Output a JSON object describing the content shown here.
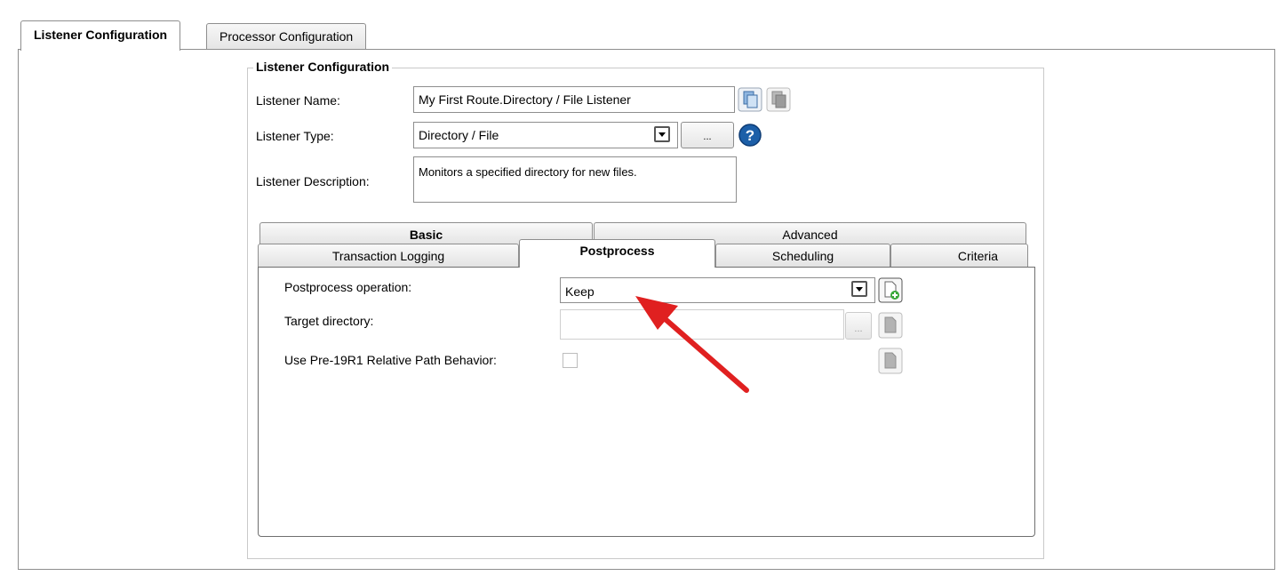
{
  "top_tabs": [
    {
      "label": "Listener Configuration",
      "active": true
    },
    {
      "label": "Processor Configuration",
      "active": false
    }
  ],
  "group": {
    "title": "Listener Configuration",
    "name_label": "Listener Name:",
    "name_value": "My First Route.Directory / File Listener",
    "type_label": "Listener Type:",
    "type_value": "Directory / File",
    "type_dots": "...",
    "description_label": "Listener Description:",
    "description_value": "Monitors a specified directory for new files."
  },
  "inner_tabs_row1": [
    "Basic",
    "Advanced"
  ],
  "inner_tabs_row2": [
    "Transaction Logging",
    "Postprocess",
    "Scheduling",
    "Criteria"
  ],
  "active_inner_tab": "Postprocess",
  "postprocess": {
    "operation_label": "Postprocess operation:",
    "operation_value": "Keep",
    "target_label": "Target directory:",
    "target_value": "",
    "target_dots": "...",
    "relative_label": "Use Pre-19R1 Relative Path Behavior:",
    "relative_checked": false
  },
  "colors": {
    "help_icon": "#1c5fa8",
    "arrow": "#e02020",
    "add_icon": "#3aa83a"
  },
  "icons": [
    "copy-icon",
    "paste-icon",
    "combo-arrow-icon",
    "help-icon",
    "add-document-icon",
    "document-icon",
    "red-arrow-annotation"
  ]
}
